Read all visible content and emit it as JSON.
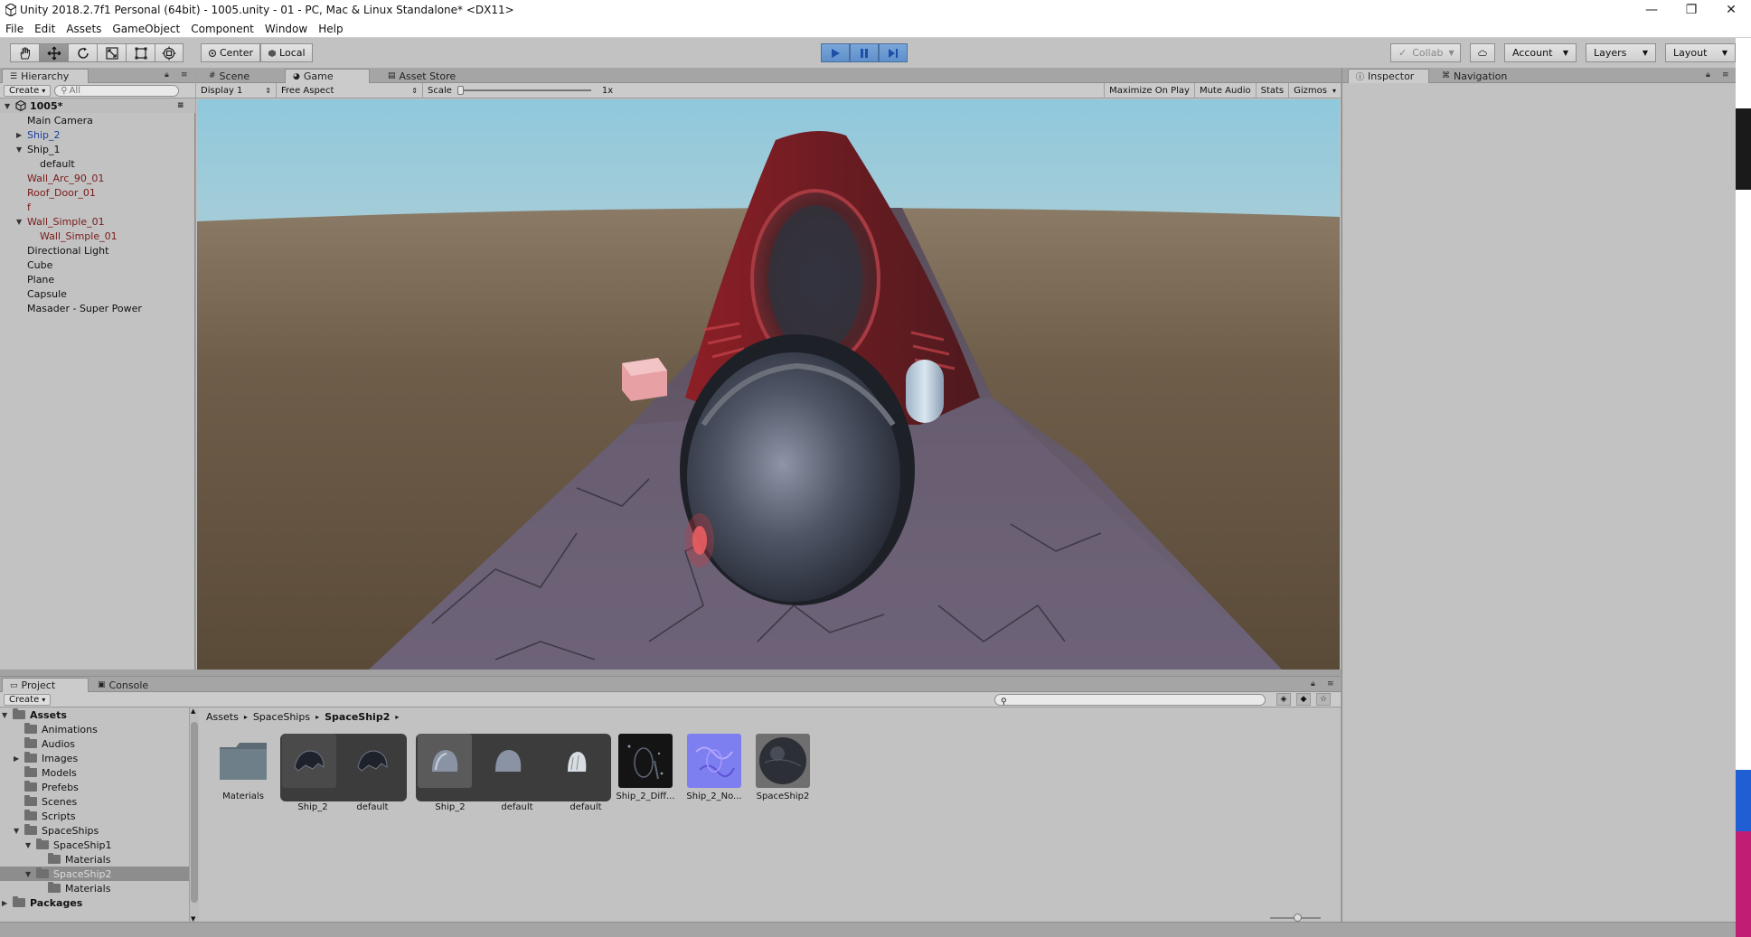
{
  "window": {
    "title": "Unity 2018.2.7f1 Personal (64bit) - 1005.unity - 01 - PC, Mac & Linux Standalone* <DX11>",
    "minimize": "—",
    "restore": "❐",
    "close": "✕"
  },
  "menu": [
    "File",
    "Edit",
    "Assets",
    "GameObject",
    "Component",
    "Window",
    "Help"
  ],
  "toolbar": {
    "pivot_center": "Center",
    "pivot_local": "Local",
    "collab": "Collab",
    "account": "Account",
    "layers": "Layers",
    "layout": "Layout",
    "play_state": "playing"
  },
  "hierarchy": {
    "tab": "Hierarchy",
    "create": "Create",
    "search_placeholder": "All",
    "scene": "1005*",
    "items": [
      {
        "label": "Main Camera",
        "depth": 1,
        "color": "normal",
        "arrow": ""
      },
      {
        "label": "Ship_2",
        "depth": 1,
        "color": "blue",
        "arrow": "collapsed"
      },
      {
        "label": "Ship_1",
        "depth": 1,
        "color": "normal",
        "arrow": "expanded"
      },
      {
        "label": "default",
        "depth": 2,
        "color": "normal",
        "arrow": ""
      },
      {
        "label": "Wall_Arc_90_01",
        "depth": 1,
        "color": "maroon",
        "arrow": ""
      },
      {
        "label": "Roof_Door_01",
        "depth": 1,
        "color": "maroon",
        "arrow": ""
      },
      {
        "label": "f",
        "depth": 1,
        "color": "maroon",
        "arrow": ""
      },
      {
        "label": "Wall_Simple_01",
        "depth": 1,
        "color": "maroon",
        "arrow": "expanded"
      },
      {
        "label": "Wall_Simple_01",
        "depth": 2,
        "color": "maroon",
        "arrow": ""
      },
      {
        "label": "Directional Light",
        "depth": 1,
        "color": "normal",
        "arrow": ""
      },
      {
        "label": "Cube",
        "depth": 1,
        "color": "normal",
        "arrow": ""
      },
      {
        "label": "Plane",
        "depth": 1,
        "color": "normal",
        "arrow": ""
      },
      {
        "label": "Capsule",
        "depth": 1,
        "color": "normal",
        "arrow": ""
      },
      {
        "label": "Masader - Super Power",
        "depth": 1,
        "color": "normal",
        "arrow": ""
      }
    ]
  },
  "center_tabs": {
    "scene": "Scene",
    "game": "Game",
    "asset_store": "Asset Store"
  },
  "game_toolbar": {
    "display": "Display 1",
    "aspect": "Free Aspect",
    "scale_label": "Scale",
    "scale_value": "1x",
    "maximize": "Maximize On Play",
    "mute": "Mute Audio",
    "stats": "Stats",
    "gizmos": "Gizmos"
  },
  "right_tabs": {
    "inspector": "Inspector",
    "navigation": "Navigation"
  },
  "bottom_tabs": {
    "project": "Project",
    "console": "Console"
  },
  "project": {
    "create": "Create",
    "folders": [
      {
        "label": "Assets",
        "depth": 0,
        "arrow": "expanded",
        "bold": true,
        "selected": false
      },
      {
        "label": "Animations",
        "depth": 1,
        "arrow": "",
        "bold": false,
        "selected": false
      },
      {
        "label": "Audios",
        "depth": 1,
        "arrow": "",
        "bold": false,
        "selected": false
      },
      {
        "label": "Images",
        "depth": 1,
        "arrow": "collapsed",
        "bold": false,
        "selected": false
      },
      {
        "label": "Models",
        "depth": 1,
        "arrow": "",
        "bold": false,
        "selected": false
      },
      {
        "label": "Prefebs",
        "depth": 1,
        "arrow": "",
        "bold": false,
        "selected": false
      },
      {
        "label": "Scenes",
        "depth": 1,
        "arrow": "",
        "bold": false,
        "selected": false
      },
      {
        "label": "Scripts",
        "depth": 1,
        "arrow": "",
        "bold": false,
        "selected": false
      },
      {
        "label": "SpaceShips",
        "depth": 1,
        "arrow": "expanded",
        "bold": false,
        "selected": false
      },
      {
        "label": "SpaceShip1",
        "depth": 2,
        "arrow": "expanded",
        "bold": false,
        "selected": false
      },
      {
        "label": "Materials",
        "depth": 3,
        "arrow": "",
        "bold": false,
        "selected": false
      },
      {
        "label": "SpaceShip2",
        "depth": 2,
        "arrow": "expanded",
        "bold": false,
        "selected": true
      },
      {
        "label": "Materials",
        "depth": 3,
        "arrow": "",
        "bold": false,
        "selected": false
      },
      {
        "label": "Packages",
        "depth": 0,
        "arrow": "collapsed",
        "bold": true,
        "selected": false
      }
    ],
    "breadcrumb": [
      "Assets",
      "SpaceShips",
      "SpaceShip2"
    ],
    "assets": [
      {
        "label": "Materials",
        "kind": "folder"
      },
      {
        "label": "Ship_2",
        "kind": "model"
      },
      {
        "label": "default",
        "kind": "mesh"
      },
      {
        "label": "Ship_2",
        "kind": "model-grey"
      },
      {
        "label": "default",
        "kind": "mesh-grey"
      },
      {
        "label": "default",
        "kind": "mesh-white"
      },
      {
        "label": "Ship_2_Diff...",
        "kind": "tex-dark"
      },
      {
        "label": "Ship_2_No...",
        "kind": "tex-normal"
      },
      {
        "label": "SpaceShip2",
        "kind": "material"
      }
    ]
  },
  "colors": {
    "editor_bg": "#c2c2c2",
    "play_blue": "#5f8fcb",
    "ship_red": "#8a2228",
    "ground": "#6b5a45"
  }
}
